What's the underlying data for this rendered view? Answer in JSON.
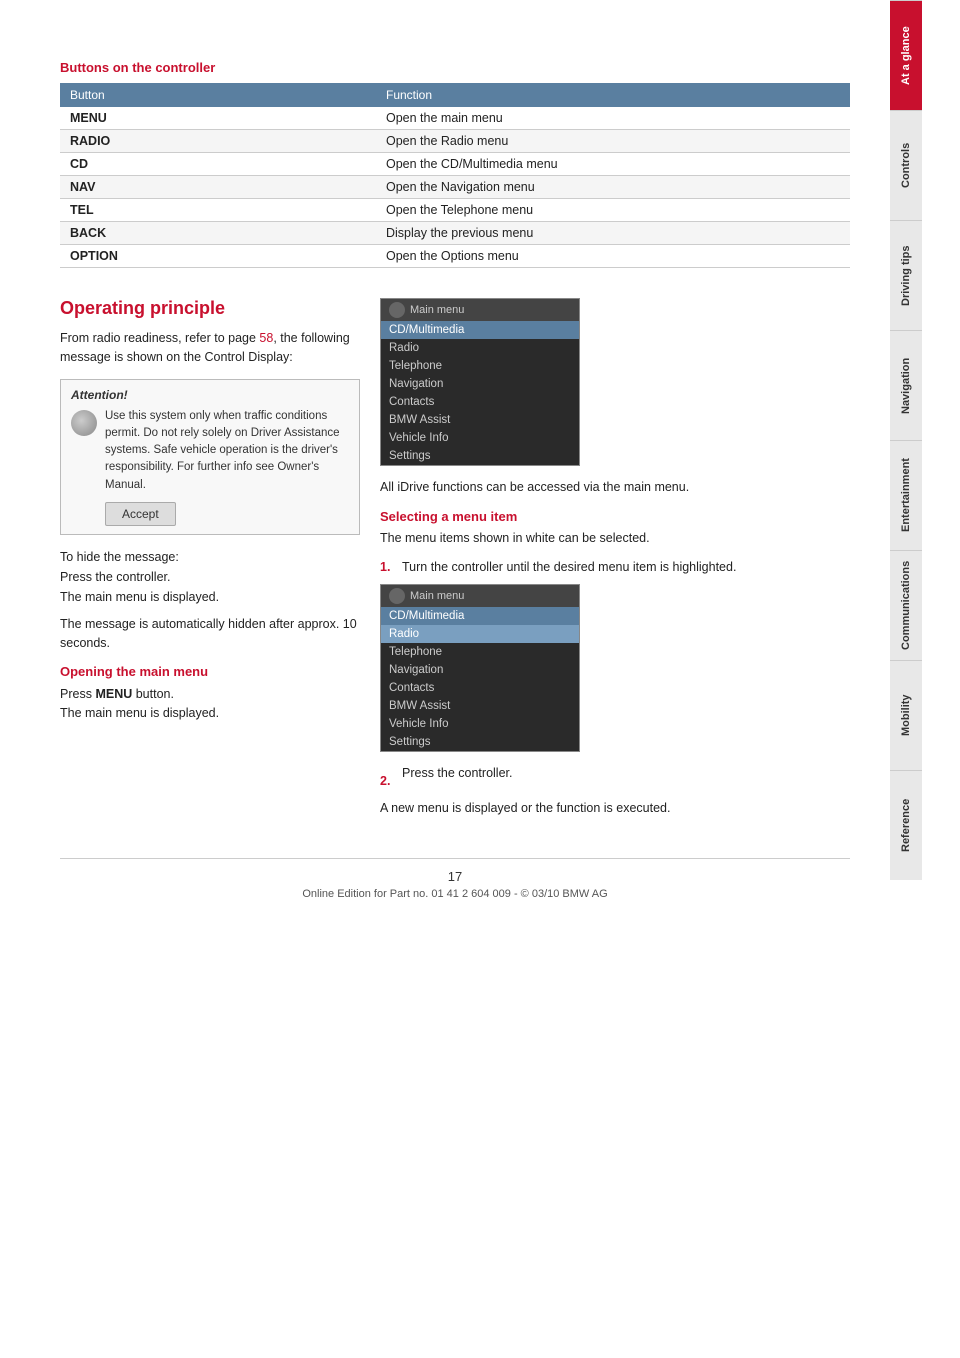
{
  "page": {
    "number": "17",
    "footer": "Online Edition for Part no. 01 41 2 604 009 - © 03/10 BMW AG"
  },
  "sidebar": {
    "tabs": [
      {
        "id": "at-a-glance",
        "label": "At a glance",
        "active": true
      },
      {
        "id": "controls",
        "label": "Controls",
        "active": false
      },
      {
        "id": "driving-tips",
        "label": "Driving tips",
        "active": false
      },
      {
        "id": "navigation",
        "label": "Navigation",
        "active": false
      },
      {
        "id": "entertainment",
        "label": "Entertainment",
        "active": false
      },
      {
        "id": "communications",
        "label": "Communications",
        "active": false
      },
      {
        "id": "mobility",
        "label": "Mobility",
        "active": false
      },
      {
        "id": "reference",
        "label": "Reference",
        "active": false
      }
    ]
  },
  "buttons_section": {
    "title": "Buttons on the controller",
    "table": {
      "headers": [
        "Button",
        "Function"
      ],
      "rows": [
        {
          "button": "MENU",
          "function": "Open the main menu"
        },
        {
          "button": "RADIO",
          "function": "Open the Radio menu"
        },
        {
          "button": "CD",
          "function": "Open the CD/Multimedia menu"
        },
        {
          "button": "NAV",
          "function": "Open the Navigation menu"
        },
        {
          "button": "TEL",
          "function": "Open the Telephone menu"
        },
        {
          "button": "BACK",
          "function": "Display the previous menu"
        },
        {
          "button": "OPTION",
          "function": "Open the Options menu"
        }
      ]
    }
  },
  "operating_principle": {
    "title": "Operating principle",
    "intro": "From radio readiness, refer to page 58, the following message is shown on the Control Display:",
    "intro_page_ref": "58",
    "attention_box": {
      "header": "Attention!",
      "text": "Use this system only when traffic conditions permit. Do not rely solely on Driver Assistance systems. Safe vehicle operation is the driver's responsibility. For further info see Owner's Manual.",
      "accept_label": "Accept"
    },
    "hide_message": {
      "line1": "To hide the message:",
      "line2": "Press the controller.",
      "line3": "The main menu is displayed."
    },
    "auto_hidden": "The message is automatically hidden after approx. 10 seconds.",
    "opening_main_menu": {
      "subheading": "Opening the main menu",
      "line1": "Press",
      "button_label": "MENU",
      "line2": "button.",
      "line3": "The main menu is displayed."
    },
    "main_menu_items_1": [
      "CD/Multimedia",
      "Radio",
      "Telephone",
      "Navigation",
      "Contacts",
      "BMW Assist",
      "Vehicle Info",
      "Settings"
    ],
    "main_menu_title": "Main menu",
    "all_idrive": "All iDrive functions can be accessed via the main menu.",
    "selecting_menu_item": {
      "subheading": "Selecting a menu item",
      "intro": "The menu items shown in white can be selected.",
      "step1": {
        "num": "1.",
        "text": "Turn the controller until the desired menu item is highlighted."
      },
      "step2": {
        "num": "2.",
        "text": "Press the controller."
      },
      "result": "A new menu is displayed or the function is executed."
    },
    "main_menu_items_2": [
      "CD/Multimedia",
      "Radio",
      "Telephone",
      "Navigation",
      "Contacts",
      "BMW Assist",
      "Vehicle Info",
      "Settings"
    ]
  }
}
